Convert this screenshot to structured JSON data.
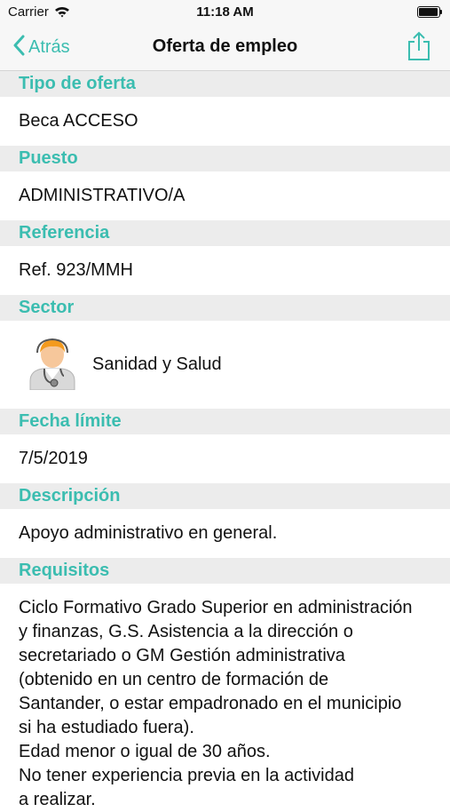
{
  "status_bar": {
    "carrier": "Carrier",
    "time": "11:18 AM"
  },
  "nav": {
    "back_label": "Atrás",
    "title": "Oferta de empleo"
  },
  "colors": {
    "accent": "#3bbdb0",
    "section_background": "#ececec"
  },
  "sections": {
    "tipo": {
      "header": "Tipo de oferta",
      "value": "Beca ACCESO"
    },
    "puesto": {
      "header": "Puesto",
      "value": "ADMINISTRATIVO/A"
    },
    "referencia": {
      "header": "Referencia",
      "value": "Ref. 923/MMH"
    },
    "sector": {
      "header": "Sector",
      "value": "Sanidad y Salud",
      "icon": "doctor-avatar-icon"
    },
    "fecha": {
      "header": "Fecha límite",
      "value": "7/5/2019"
    },
    "descripcion": {
      "header": "Descripción",
      "value": "Apoyo administrativo en general."
    },
    "requisitos": {
      "header": "Requisitos",
      "value": "Ciclo Formativo Grado Superior en administración\ny finanzas, G.S. Asistencia a la dirección o\nsecretariado o GM Gestión administrativa\n(obtenido en un centro de formación de\nSantander, o estar empadronado en el municipio\nsi ha estudiado fuera).\nEdad menor o igual de 30 años.\nNo tener experiencia previa en la actividad\na realizar."
    }
  }
}
